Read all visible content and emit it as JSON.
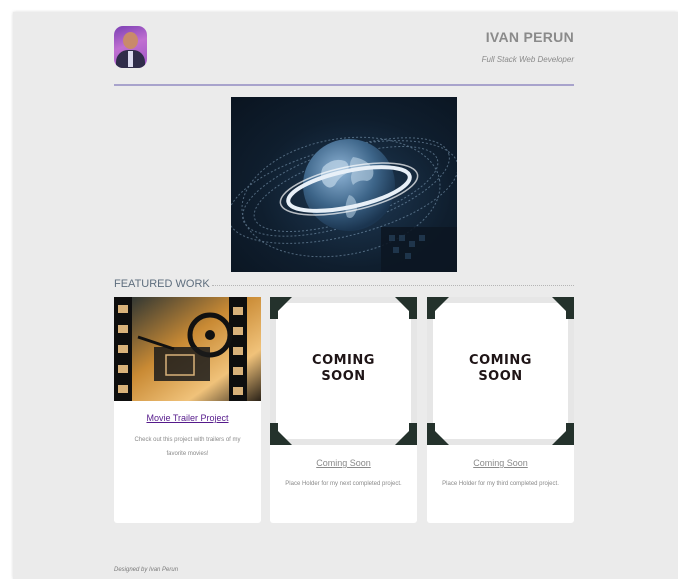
{
  "header": {
    "name": "IVAN PERUN",
    "role": "Full Stack Web Developer"
  },
  "featured": {
    "section_title": "FEATURED WORK",
    "cards": [
      {
        "title": "Movie Trailer Project",
        "description": "Check out this project with trailers of my favorite movies!",
        "title_color": "#551a8b"
      },
      {
        "title": "Coming Soon",
        "description": "Place Holder for my next completed project.",
        "image_text_line1": "COMING",
        "image_text_line2": "SOON",
        "title_color": "#8a8a8a"
      },
      {
        "title": "Coming Soon",
        "description": "Place Holder for my third completed project.",
        "image_text_line1": "COMING",
        "image_text_line2": "SOON",
        "title_color": "#8a8a8a"
      }
    ]
  },
  "footer": {
    "credit": "Designed by Ivan Perun"
  },
  "colors": {
    "page_background": "#ebebeb",
    "header_rule": "#a8a3cc",
    "visited_link": "#551a8b",
    "muted_text": "#8a8a8a"
  },
  "icons": {
    "avatar": "profile-photo",
    "hero": "globe-with-data-rings"
  }
}
